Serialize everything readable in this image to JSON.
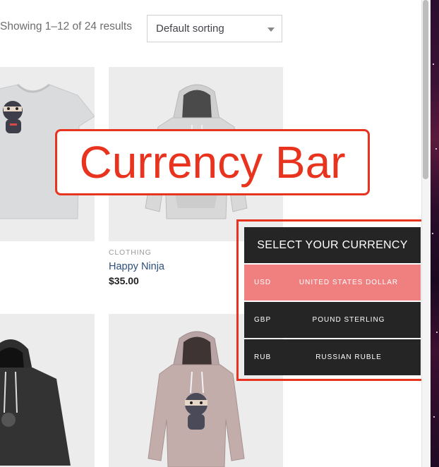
{
  "toolbar": {
    "result_count": "Showing 1–12 of 24 results",
    "sorting": "Default sorting"
  },
  "products": [
    {
      "image": "ninja-tshirt-image"
    },
    {
      "image": "grey-hoodie-image",
      "category": "CLOTHING",
      "name": "Happy Ninja",
      "price": "$35.00"
    },
    {
      "image": "black-hoodie-image"
    },
    {
      "image": "pink-ninja-hoodie-image"
    }
  ],
  "callout": {
    "label": "Currency Bar"
  },
  "currency_bar": {
    "title": "SELECT YOUR CURRENCY",
    "options": [
      {
        "code": "USD",
        "name": "UNITED STATES DOLLAR",
        "active": true
      },
      {
        "code": "GBP",
        "name": "POUND STERLING",
        "active": false
      },
      {
        "code": "RUB",
        "name": "RUSSIAN RUBLE",
        "active": false
      }
    ]
  },
  "colors": {
    "active_currency": "#f08080",
    "panel_bg": "#252525",
    "annotation_red": "#e8331f",
    "link_blue": "#2c4f7c"
  }
}
